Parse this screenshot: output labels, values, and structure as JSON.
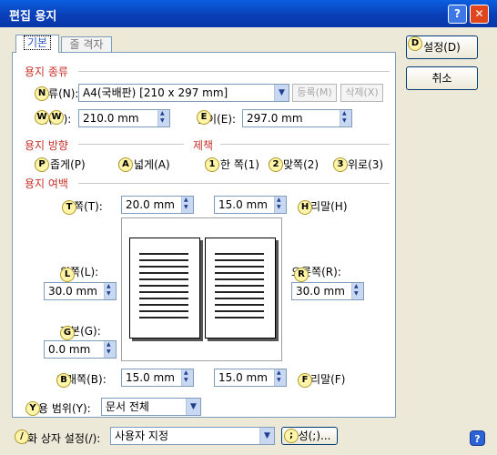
{
  "window": {
    "title": "편집 용지",
    "help_glyph": "?",
    "close_glyph": "✕"
  },
  "tabs": [
    {
      "label": "기본"
    },
    {
      "label": "줄 격자"
    }
  ],
  "sections": {
    "paper_type": "용지 종류",
    "orientation": "용지 방향",
    "binding": "제책",
    "margins": "용지 여백"
  },
  "paper": {
    "kind_label": "종류(N):",
    "kind_value": "A4(국배판) [210 x 297 mm]",
    "register": "등록(M)",
    "delete": "삭제(X)",
    "width_label": "폭(W):",
    "width_value": "210.0 mm",
    "length_label": "길이(E):",
    "length_value": "297.0 mm"
  },
  "orientation": {
    "portrait": "좁게(P)",
    "landscape": "넓게(A)"
  },
  "binding": {
    "single": "한 쪽(1)",
    "facing": "맞쪽(2)",
    "top": "위로(3)"
  },
  "margins": {
    "top_label": "위쪽(T):",
    "top_value": "20.0 mm",
    "header_value": "15.0 mm",
    "header_label": "머리말(H)",
    "left_label": "왼쪽(L):",
    "left_value": "30.0 mm",
    "right_label": "오른쪽(R):",
    "right_value": "30.0 mm",
    "gutter_label": "제본(G):",
    "gutter_value": "0.0 mm",
    "bottom_label": "아래쪽(B):",
    "bottom_value": "15.0 mm",
    "footer_value": "15.0 mm",
    "footer_label": "꼬리말(F)",
    "apply_label": "적용 범위(Y):",
    "apply_value": "문서 전체"
  },
  "dialog": {
    "setting_label": "대화 상자 설정(/):",
    "setting_value": "사용자 지정",
    "config_button": "구성(;)..."
  },
  "buttons": {
    "ok": "설정(D)",
    "cancel": "취소"
  },
  "hotkeys": {
    "kind": "N",
    "width": "W",
    "length": "E",
    "portrait": "P",
    "landscape": "A",
    "single": "1",
    "facing": "2",
    "top": "3",
    "top_margin": "T",
    "header": "H",
    "left": "L",
    "right": "R",
    "gutter": "G",
    "bottom": "B",
    "footer": "F",
    "apply": "Y",
    "setting": "/",
    "config": ";",
    "ok": "D"
  },
  "preview": {
    "lines": 11
  }
}
